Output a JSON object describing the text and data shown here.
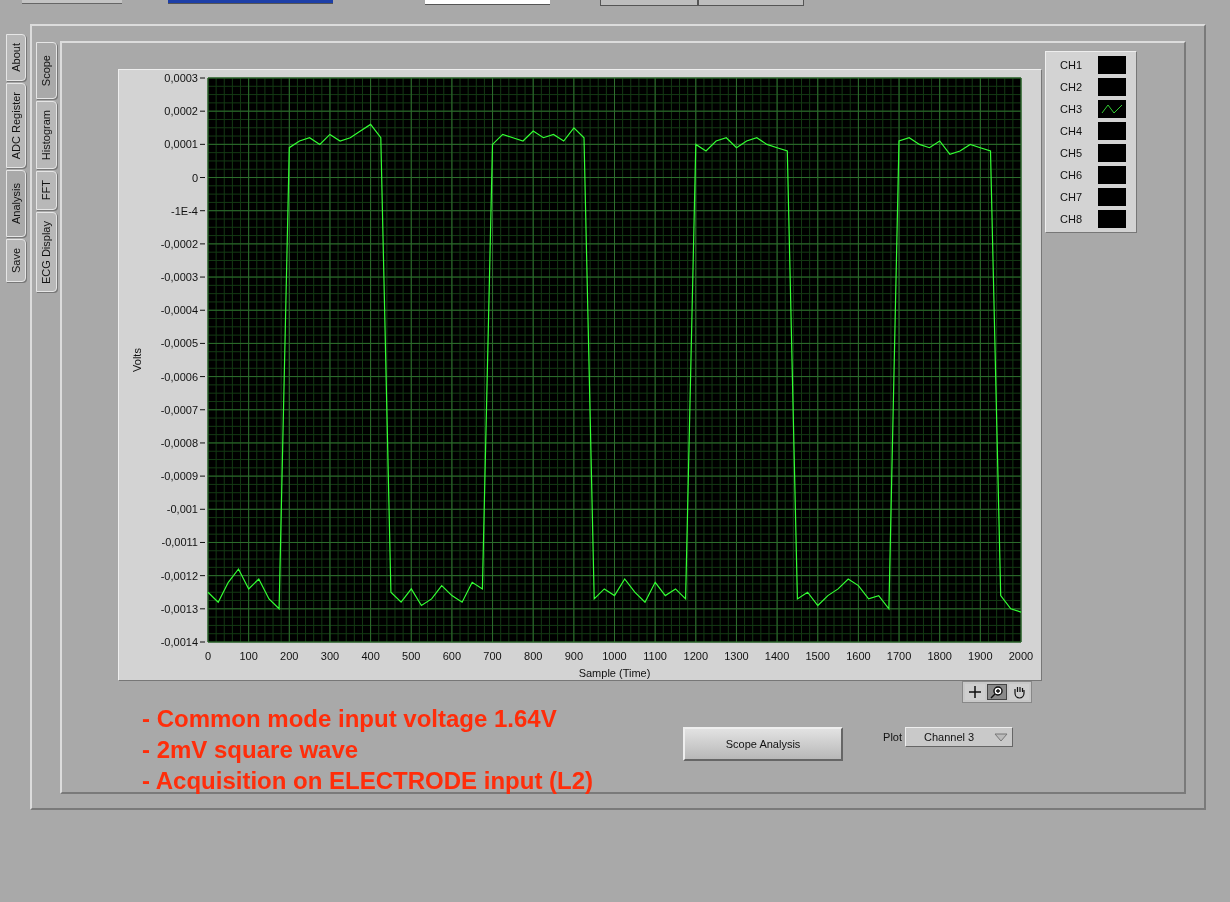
{
  "outer_tabs": [
    {
      "label": "About",
      "selected": false
    },
    {
      "label": "ADC Register",
      "selected": false
    },
    {
      "label": "Analysis",
      "selected": true
    },
    {
      "label": "Save",
      "selected": false
    }
  ],
  "inner_tabs": [
    {
      "label": "Scope",
      "selected": true
    },
    {
      "label": "Histogram",
      "selected": false
    },
    {
      "label": "FFT",
      "selected": false
    },
    {
      "label": "ECG Display",
      "selected": false
    }
  ],
  "graph": {
    "chart_data": {
      "type": "line",
      "grid": true,
      "xlabel": "Sample (Time)",
      "ylabel": "Volts",
      "xlim": [
        0,
        2000
      ],
      "ylim": [
        -0.0014,
        0.0003
      ],
      "xticks": [
        0,
        100,
        200,
        300,
        400,
        500,
        600,
        700,
        800,
        900,
        1000,
        1100,
        1200,
        1300,
        1400,
        1500,
        1600,
        1700,
        1800,
        1900,
        2000
      ],
      "yticks": [
        {
          "value": 0.0003,
          "label": "0,0003"
        },
        {
          "value": 0.0002,
          "label": "0,0002"
        },
        {
          "value": 0.0001,
          "label": "0,0001"
        },
        {
          "value": 0,
          "label": "0"
        },
        {
          "value": -0.0001,
          "label": "-1E-4"
        },
        {
          "value": -0.0002,
          "label": "-0,0002"
        },
        {
          "value": -0.0003,
          "label": "-0,0003"
        },
        {
          "value": -0.0004,
          "label": "-0,0004"
        },
        {
          "value": -0.0005,
          "label": "-0,0005"
        },
        {
          "value": -0.0006,
          "label": "-0,0006"
        },
        {
          "value": -0.0007,
          "label": "-0,0007"
        },
        {
          "value": -0.0008,
          "label": "-0,0008"
        },
        {
          "value": -0.0009,
          "label": "-0,0009"
        },
        {
          "value": -0.001,
          "label": "-0,001"
        },
        {
          "value": -0.0011,
          "label": "-0,0011"
        },
        {
          "value": -0.0012,
          "label": "-0,0012"
        },
        {
          "value": -0.0013,
          "label": "-0,0013"
        },
        {
          "value": -0.0014,
          "label": "-0,0014"
        }
      ],
      "x": [
        0,
        25,
        50,
        75,
        100,
        125,
        150,
        175,
        200,
        225,
        250,
        275,
        300,
        325,
        350,
        375,
        400,
        425,
        450,
        475,
        500,
        525,
        550,
        575,
        600,
        625,
        650,
        675,
        700,
        725,
        750,
        775,
        800,
        825,
        850,
        875,
        900,
        925,
        950,
        975,
        1000,
        1025,
        1050,
        1075,
        1100,
        1125,
        1150,
        1175,
        1200,
        1225,
        1250,
        1275,
        1300,
        1325,
        1350,
        1375,
        1400,
        1425,
        1450,
        1475,
        1500,
        1525,
        1550,
        1575,
        1600,
        1625,
        1650,
        1675,
        1700,
        1725,
        1750,
        1775,
        1800,
        1825,
        1850,
        1875,
        1900,
        1925,
        1950,
        1975,
        2000
      ],
      "series": [
        {
          "color": "#33ff33",
          "values": [
            -0.00125,
            -0.00128,
            -0.00122,
            -0.00118,
            -0.00124,
            -0.00121,
            -0.00127,
            -0.0013,
            9e-05,
            0.00011,
            0.00012,
            0.0001,
            0.00013,
            0.00011,
            0.00012,
            0.00014,
            0.00016,
            0.00012,
            -0.00125,
            -0.00128,
            -0.00124,
            -0.00129,
            -0.00127,
            -0.00123,
            -0.00126,
            -0.00128,
            -0.00122,
            -0.00124,
            0.0001,
            0.00013,
            0.00012,
            0.00011,
            0.00014,
            0.00012,
            0.00013,
            0.00011,
            0.00015,
            0.00012,
            -0.00127,
            -0.00124,
            -0.00126,
            -0.00121,
            -0.00125,
            -0.00128,
            -0.00122,
            -0.00126,
            -0.00124,
            -0.00127,
            0.0001,
            8e-05,
            0.00011,
            0.00012,
            9e-05,
            0.00011,
            0.00012,
            0.0001,
            9e-05,
            8e-05,
            -0.00127,
            -0.00125,
            -0.00129,
            -0.00126,
            -0.00124,
            -0.00121,
            -0.00123,
            -0.00127,
            -0.00126,
            -0.0013,
            0.00011,
            0.00012,
            0.0001,
            9e-05,
            0.00011,
            7e-05,
            8e-05,
            0.0001,
            9e-05,
            8e-05,
            -0.00126,
            -0.0013,
            -0.00131
          ]
        }
      ]
    }
  },
  "legend": [
    {
      "label": "CH1",
      "plotted": false
    },
    {
      "label": "CH2",
      "plotted": false
    },
    {
      "label": "CH3",
      "plotted": true
    },
    {
      "label": "CH4",
      "plotted": false
    },
    {
      "label": "CH5",
      "plotted": false
    },
    {
      "label": "CH6",
      "plotted": false
    },
    {
      "label": "CH7",
      "plotted": false
    },
    {
      "label": "CH8",
      "plotted": false
    }
  ],
  "graph_tools": [
    {
      "kind": "cursor",
      "selected": false
    },
    {
      "kind": "zoom",
      "selected": true
    },
    {
      "kind": "pan",
      "selected": false
    }
  ],
  "notes": [
    "- Common mode input voltage 1.64V",
    "- 2mV square wave",
    "- Acquisition on ELECTRODE input (L2)"
  ],
  "scope_button": "Scope Analysis",
  "plot_select": {
    "label": "Plot",
    "value": "Channel 3"
  }
}
